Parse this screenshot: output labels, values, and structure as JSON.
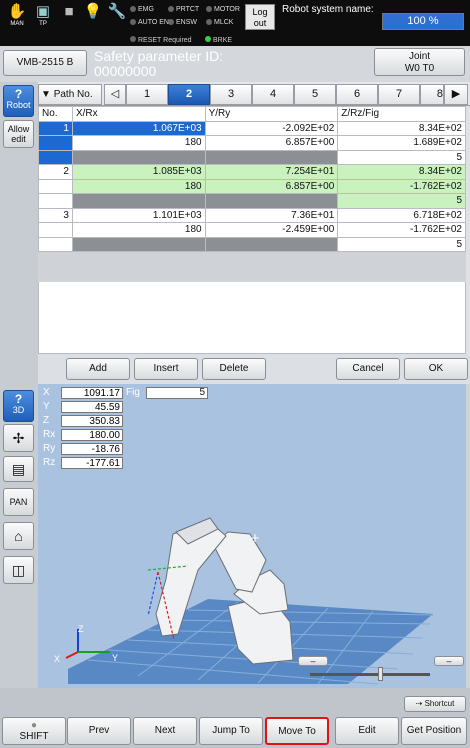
{
  "topbar": {
    "man_label": "MAN",
    "tp_label": "TP",
    "signals_row1": [
      "EMG",
      "PRTCT",
      "MOTOR"
    ],
    "signals_row2": [
      "AUTO EN",
      "ENSW",
      "MLCK"
    ],
    "logout_label": "Log out",
    "robot_system_name_label": "Robot system name:",
    "progress_text": "100 %",
    "progress_value": 1.0,
    "status_row": [
      "RESET Required",
      "BRKE"
    ]
  },
  "header": {
    "model_button": "VMB-2515 B",
    "safety_id_label": "Safety parameter ID:",
    "safety_id_value": "00000000",
    "joint_button": "Joint\nW0 T0"
  },
  "sidebar": {
    "robot": "Robot",
    "allow_edit": "Allow edit",
    "view_3d": "3D",
    "pan": "PAN"
  },
  "path_tabs": {
    "selector_label": "Path No.",
    "tabs": [
      "1",
      "2",
      "3",
      "4",
      "5",
      "6",
      "7",
      "8"
    ],
    "selected": "2"
  },
  "table": {
    "columns": [
      "No.",
      "X/Rx",
      "Y/Ry",
      "Z/Rz/Fig"
    ],
    "rows": [
      {
        "no": "1",
        "state": "selected",
        "lines": [
          [
            "1.067E+03",
            "-2.092E+02",
            "8.34E+02"
          ],
          [
            "180",
            "6.857E+00",
            "1.689E+02"
          ],
          [
            "",
            "",
            "5"
          ]
        ]
      },
      {
        "no": "2",
        "state": "highlight",
        "lines": [
          [
            "1.085E+03",
            "7.254E+01",
            "8.34E+02"
          ],
          [
            "180",
            "6.857E+00",
            "-1.762E+02"
          ],
          [
            "",
            "",
            "5"
          ]
        ]
      },
      {
        "no": "3",
        "state": "normal",
        "lines": [
          [
            "1.101E+03",
            "7.36E+01",
            "6.718E+02"
          ],
          [
            "180",
            "-2.459E+00",
            "-1.762E+02"
          ],
          [
            "",
            "",
            "5"
          ]
        ]
      }
    ]
  },
  "edit_buttons": {
    "add": "Add",
    "insert": "Insert",
    "delete": "Delete",
    "cancel": "Cancel",
    "ok": "OK"
  },
  "coords": [
    {
      "k": "X",
      "v": "1091.17"
    },
    {
      "k": "Y",
      "v": "45.59"
    },
    {
      "k": "Z",
      "v": "350.83"
    },
    {
      "k": "Rx",
      "v": "180.00"
    },
    {
      "k": "Ry",
      "v": "-18.76"
    },
    {
      "k": "Rz",
      "v": "-177.61"
    }
  ],
  "fig": {
    "label": "Fig",
    "value": "5"
  },
  "axes": {
    "x": "X",
    "y": "Y",
    "z": "Z"
  },
  "shortcut_label": "Shortcut",
  "bottom_buttons": {
    "shift": "SHIFT",
    "prev": "Prev",
    "next": "Next",
    "jump_to": "Jump To",
    "move_to": "Move To",
    "edit": "Edit",
    "get_position": "Get Position"
  },
  "colors": {
    "accent": "#1c6ad1",
    "highlight": "#c9f2bf",
    "focus": "#e01414"
  }
}
